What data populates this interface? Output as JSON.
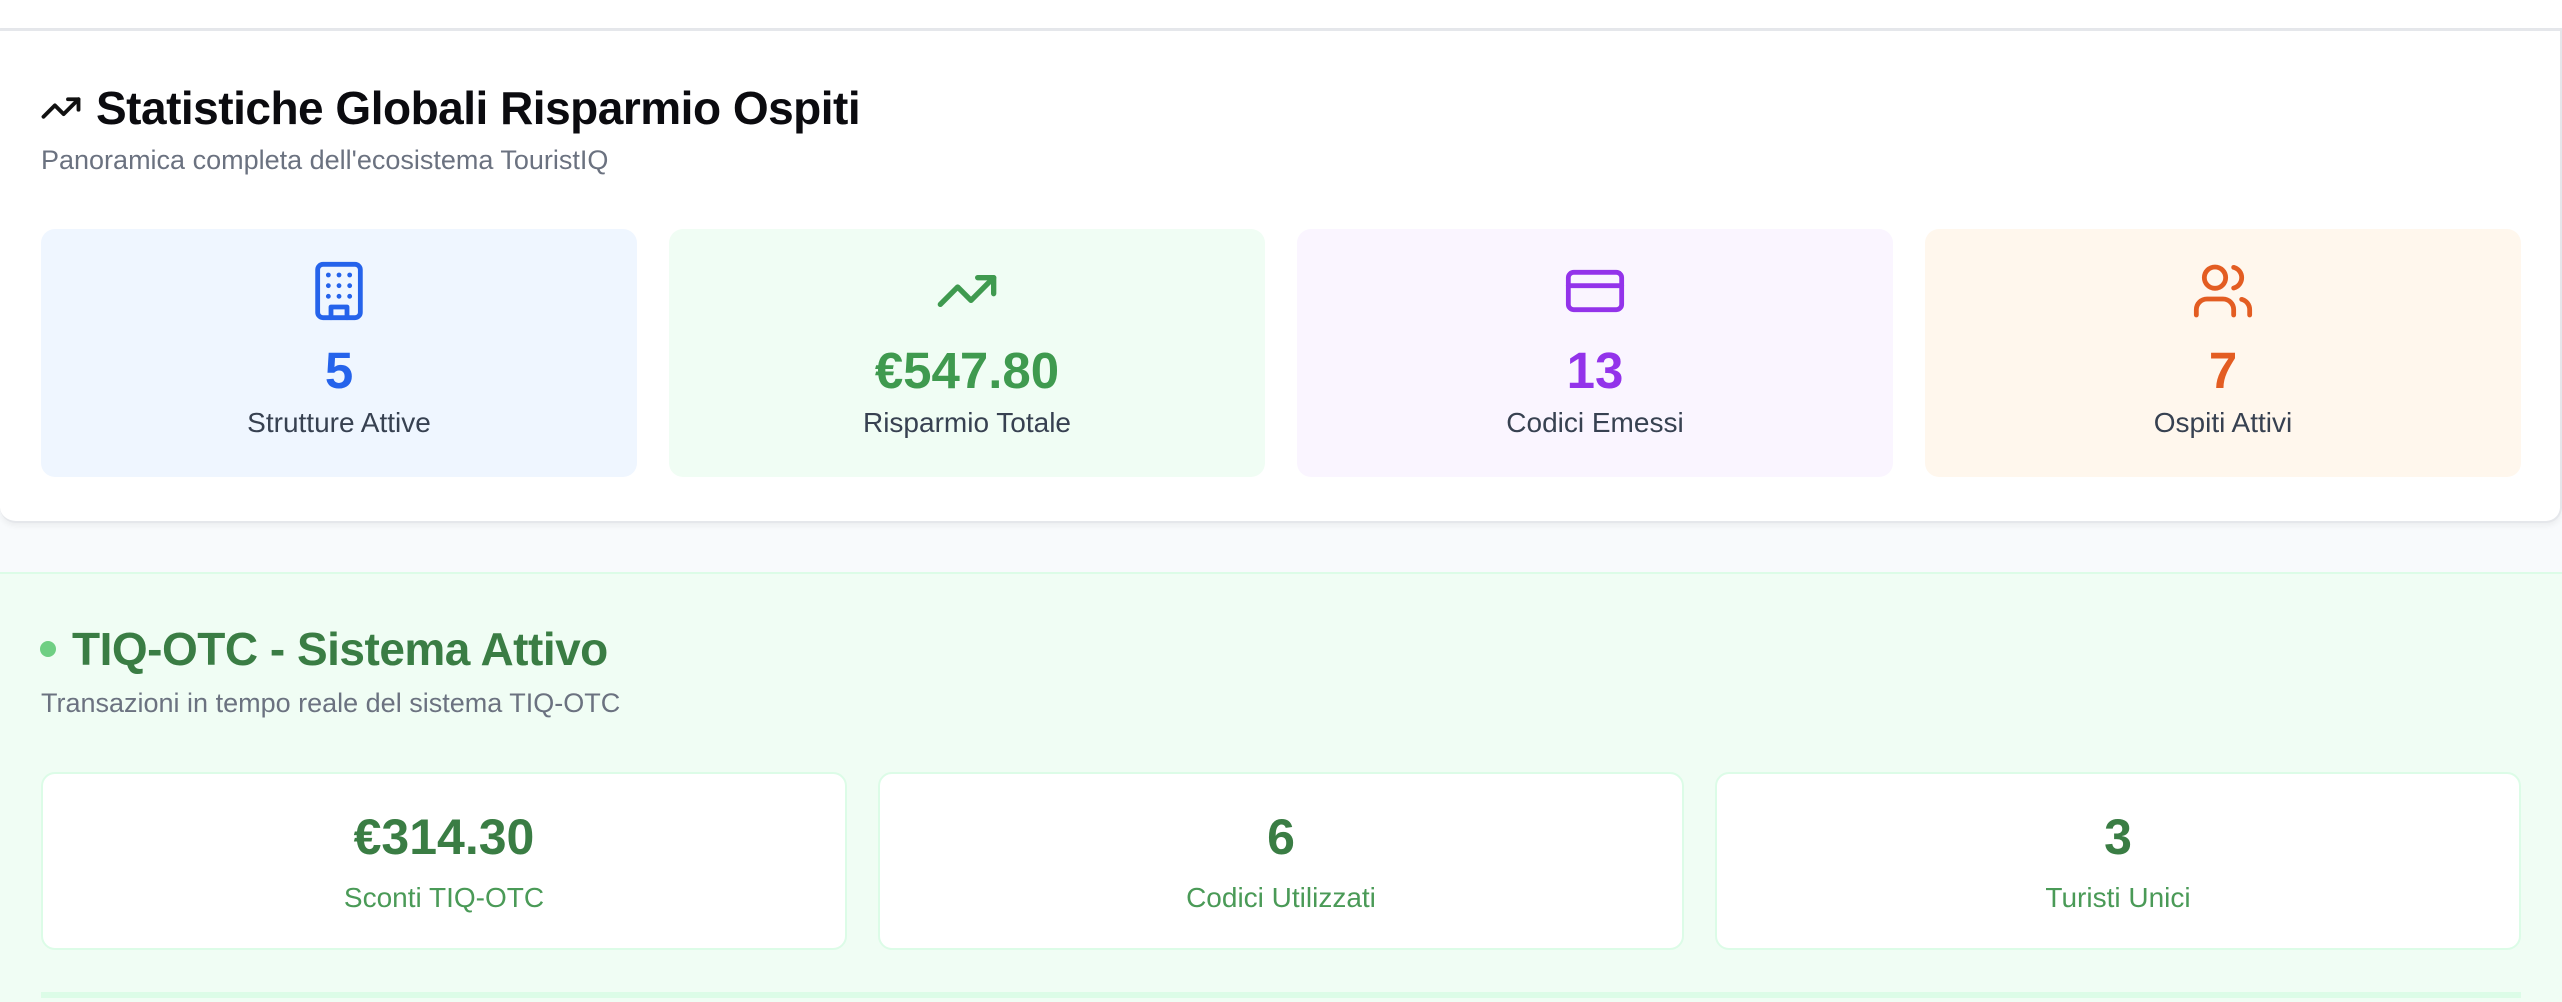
{
  "stats": {
    "title": "Statistiche Globali Risparmio Ospiti",
    "subtitle": "Panoramica completa dell'ecosistema TouristIQ",
    "title_icon": "trending-up-icon",
    "tiles": [
      {
        "icon": "building-icon",
        "value": "5",
        "label": "Strutture Attive",
        "color": "#2563eb",
        "bg": "#eff6ff"
      },
      {
        "icon": "trending-up-icon",
        "value": "€547.80",
        "label": "Risparmio Totale",
        "color": "#3f9a4f",
        "bg": "#f0fdf4"
      },
      {
        "icon": "credit-card-icon",
        "value": "13",
        "label": "Codici Emessi",
        "color": "#9333ea",
        "bg": "#faf5ff"
      },
      {
        "icon": "users-icon",
        "value": "7",
        "label": "Ospiti Attivi",
        "color": "#e35d22",
        "bg": "#fff7ed"
      }
    ]
  },
  "otc": {
    "title": "TIQ-OTC - Sistema Attivo",
    "subtitle": "Transazioni in tempo reale del sistema TIQ-OTC",
    "status_color": "#6fcf83",
    "tiles": [
      {
        "value": "€314.30",
        "label": "Sconti TIQ-OTC"
      },
      {
        "value": "6",
        "label": "Codici Utilizzati"
      },
      {
        "value": "3",
        "label": "Turisti Unici"
      }
    ]
  }
}
